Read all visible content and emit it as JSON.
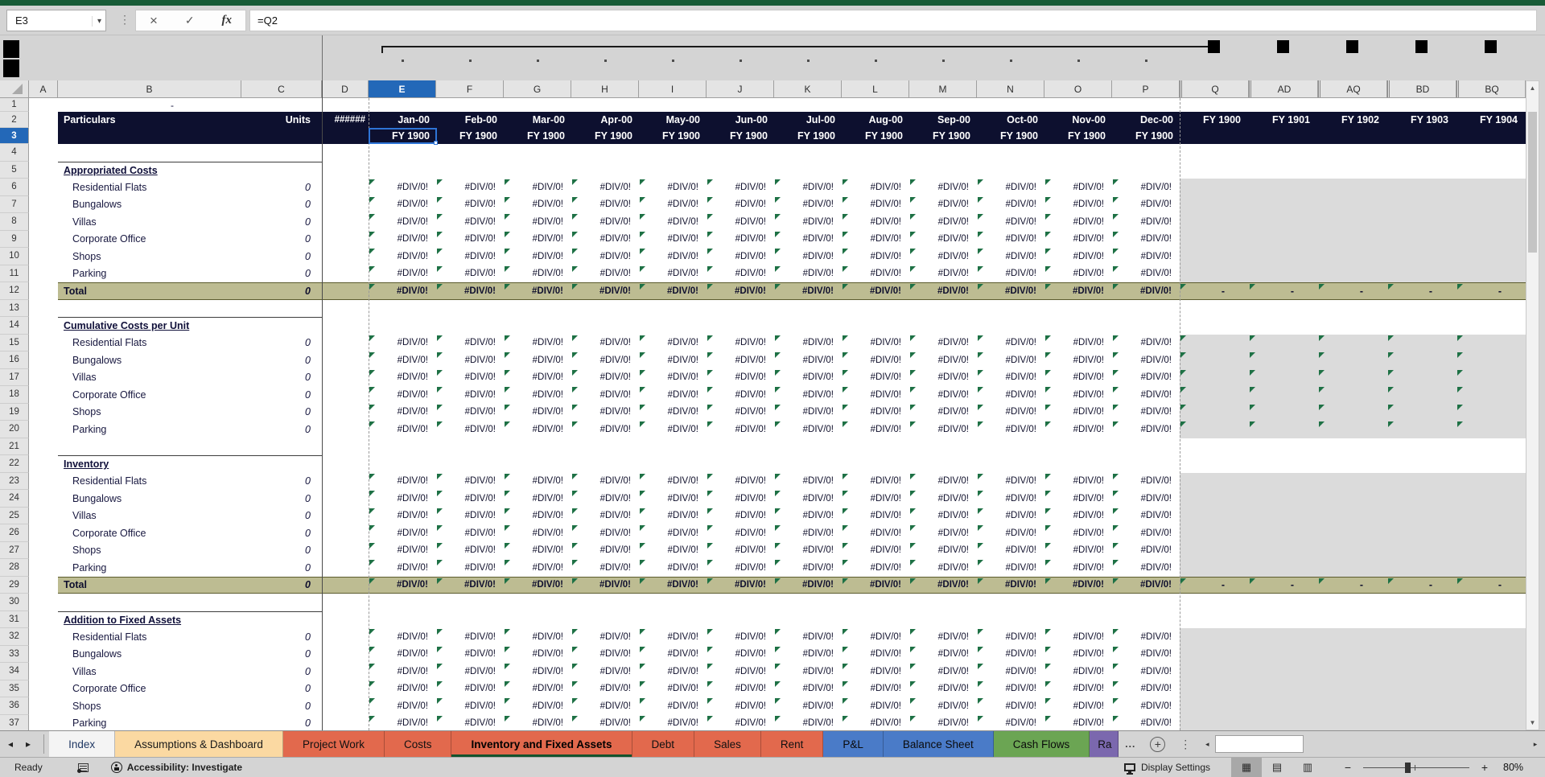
{
  "formula_bar": {
    "name_box": "E3",
    "formula": "=Q2"
  },
  "icons": {
    "name_box_dropdown": "▾",
    "cancel": "×",
    "enter": "✓",
    "function": "fx",
    "menu_dots": "⋮",
    "tab_scroll_left": "◂",
    "tab_scroll_right": "▸",
    "hscroll_left": "◂",
    "hscroll_right": "▸",
    "scroll_up": "▲",
    "scroll_down": "▼",
    "add_sheet": "+",
    "more_tabs": "...",
    "view_normal": "▦",
    "view_page_layout": "▤",
    "view_page_break": "▥",
    "zoom_out": "−",
    "zoom_in": "+"
  },
  "grid": {
    "columns": [
      "A",
      "B",
      "C",
      "D",
      "E",
      "F",
      "G",
      "H",
      "I",
      "J",
      "K",
      "L",
      "M",
      "N",
      "O",
      "P",
      "Q",
      "AD",
      "AQ",
      "BD",
      "BQ"
    ],
    "selected_column": "E",
    "selected_row": 3,
    "selected_cell": "E3",
    "row_count": 37,
    "row1_value": "-",
    "header": {
      "particulars": "Particulars",
      "units": "Units",
      "d_value": "######",
      "months": [
        "Jan-00",
        "Feb-00",
        "Mar-00",
        "Apr-00",
        "May-00",
        "Jun-00",
        "Jul-00",
        "Aug-00",
        "Sep-00",
        "Oct-00",
        "Nov-00",
        "Dec-00"
      ],
      "fy_columns": [
        "FY 1900",
        "FY 1901",
        "FY 1902",
        "FY 1903",
        "FY 1904"
      ],
      "fy_row3": "FY 1900"
    },
    "units_value": "0",
    "error_value": "#DIV/0!",
    "dash": "-",
    "sections": [
      {
        "title": "Appropriated Costs",
        "title_row": 5,
        "items_start_row": 6,
        "items": [
          "Residential Flats",
          "Bungalows",
          "Villas",
          "Corporate Office",
          "Shops",
          "Parking"
        ],
        "total_row": 12,
        "total_label": "Total",
        "total_units": "0",
        "right_region": "shaded"
      },
      {
        "title": "Cumulative Costs per Unit",
        "title_row": 14,
        "items_start_row": 15,
        "items": [
          "Residential Flats",
          "Bungalows",
          "Villas",
          "Corporate Office",
          "Shops",
          "Parking"
        ],
        "total_row": null,
        "right_region": "shaded-flagged"
      },
      {
        "title": "Inventory",
        "title_row": 22,
        "items_start_row": 23,
        "items": [
          "Residential Flats",
          "Bungalows",
          "Villas",
          "Corporate Office",
          "Shops",
          "Parking"
        ],
        "total_row": 29,
        "total_label": "Total",
        "total_units": "0",
        "right_region": "shaded"
      },
      {
        "title": "Addition to Fixed Assets",
        "title_row": 31,
        "items_start_row": 32,
        "items": [
          "Residential Flats",
          "Bungalows",
          "Villas",
          "Corporate Office",
          "Shops",
          "Parking"
        ],
        "total_row": null,
        "right_region": "shaded"
      }
    ]
  },
  "tabs": {
    "items": [
      {
        "label": "Index",
        "color": "#f4f4f4",
        "text": "#203864",
        "active": false,
        "truncated": false
      },
      {
        "label": "Assumptions & Dashboard",
        "color": "#fbd9a2",
        "text": "#1a1a1a",
        "active": false,
        "truncated": false
      },
      {
        "label": "Project Work",
        "color": "#e2694d",
        "text": "#111111",
        "active": false,
        "truncated": false
      },
      {
        "label": "Costs",
        "color": "#e2694d",
        "text": "#111111",
        "active": false,
        "truncated": false
      },
      {
        "label": "Inventory and Fixed Assets",
        "color": "#e2694d",
        "text": "#000000",
        "active": true,
        "truncated": false
      },
      {
        "label": "Debt",
        "color": "#e2694d",
        "text": "#111111",
        "active": false,
        "truncated": false
      },
      {
        "label": "Sales",
        "color": "#e2694d",
        "text": "#111111",
        "active": false,
        "truncated": false
      },
      {
        "label": "Rent",
        "color": "#e2694d",
        "text": "#111111",
        "active": false,
        "truncated": false
      },
      {
        "label": "P&L",
        "color": "#4a7bc8",
        "text": "#0b0b0b",
        "active": false,
        "truncated": false
      },
      {
        "label": "Balance Sheet",
        "color": "#4a7bc8",
        "text": "#0b0b0b",
        "active": false,
        "truncated": false
      },
      {
        "label": "Cash Flows",
        "color": "#6ba553",
        "text": "#0b0b0b",
        "active": false,
        "truncated": false
      },
      {
        "label": "Ra",
        "color": "#7b68ae",
        "text": "#111111",
        "active": false,
        "truncated": true
      }
    ]
  },
  "status_bar": {
    "mode": "Ready",
    "accessibility": "Accessibility: Investigate",
    "display_settings": "Display Settings",
    "zoom_percent": "80%"
  },
  "colors": {
    "header_band": "#0d102f",
    "total_row": "#bdbc92",
    "error_flag": "#1e7145",
    "selection": "#2368b8",
    "shaded_region": "#dbdbdb",
    "ribbon_green": "#185c37"
  }
}
